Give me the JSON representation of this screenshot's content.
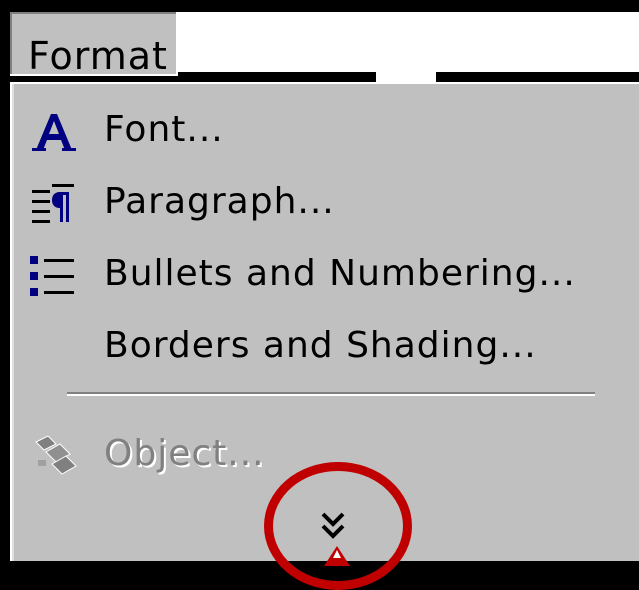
{
  "menu": {
    "title": "Format",
    "title_mnemonic": "o",
    "items": [
      {
        "label": "Font...",
        "icon": "font-icon",
        "enabled": true
      },
      {
        "label": "Paragraph...",
        "icon": "paragraph-icon",
        "enabled": true
      },
      {
        "label": "Bullets and Numbering...",
        "icon": "bullets-icon",
        "enabled": true
      },
      {
        "label": "Borders and Shading...",
        "icon": "",
        "enabled": true
      },
      {
        "label": "Object...",
        "icon": "object-icon",
        "enabled": false
      }
    ],
    "expand_icon": "double-chevron-down-icon"
  },
  "colors": {
    "menu_bg": "#c0c0c0",
    "text": "#000000",
    "disabled_text": "#808080",
    "icon_blue": "#000080",
    "highlight_circle": "#c00000"
  }
}
